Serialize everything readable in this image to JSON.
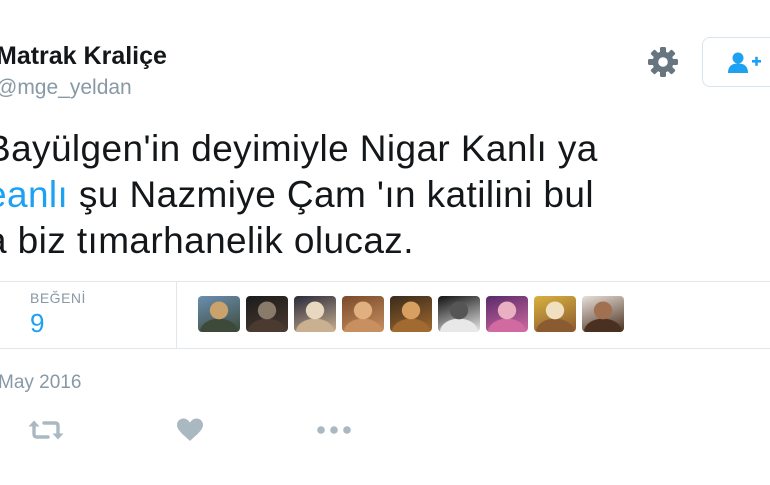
{
  "profile": {
    "display_name": "Matrak Kraliçe",
    "handle": "@mge_yeldan"
  },
  "tweet": {
    "line1": "Bayülgen'in deyimiyle Nigar Kanlı ya",
    "line2_link": "eanlı",
    "line2_rest": " şu Nazmiye Çam 'ın katilini bul",
    "line3": "a biz tımarhanelik olucaz."
  },
  "stats": {
    "likes_label": "BEĞENİ",
    "likes_count": "9"
  },
  "liker_avatars": [
    {
      "name": "avatar-1",
      "colors": [
        "#6b8fb0",
        "#3d4a3a",
        "#c9a36b"
      ]
    },
    {
      "name": "avatar-2",
      "colors": [
        "#1b1b1b",
        "#4a3a30",
        "#8a7a6a"
      ]
    },
    {
      "name": "avatar-3",
      "colors": [
        "#2a2a3a",
        "#c8b090",
        "#e8d8c0"
      ]
    },
    {
      "name": "avatar-4",
      "colors": [
        "#7a4a2a",
        "#c89060",
        "#e0b080"
      ]
    },
    {
      "name": "avatar-5",
      "colors": [
        "#3a2a1a",
        "#a06a30",
        "#d8a060"
      ]
    },
    {
      "name": "avatar-6",
      "colors": [
        "#111111",
        "#e8e8e8",
        "#555555"
      ]
    },
    {
      "name": "avatar-7",
      "colors": [
        "#5a2a6a",
        "#d06aa0",
        "#e8b0c0"
      ]
    },
    {
      "name": "avatar-8",
      "colors": [
        "#d8b040",
        "#8a5a30",
        "#f0e0c0"
      ]
    },
    {
      "name": "avatar-9",
      "colors": [
        "#e8e0d8",
        "#4a3020",
        "#a07050"
      ]
    }
  ],
  "meta": {
    "date": "May 2016"
  },
  "colors": {
    "link": "#1da1f2",
    "muted": "#8899a6",
    "action_icon": "#aab8c2"
  },
  "icons": {
    "settings": "gear-icon",
    "follow": "follow-user-icon",
    "retweet": "retweet-icon",
    "like": "heart-icon",
    "more": "more-icon"
  }
}
